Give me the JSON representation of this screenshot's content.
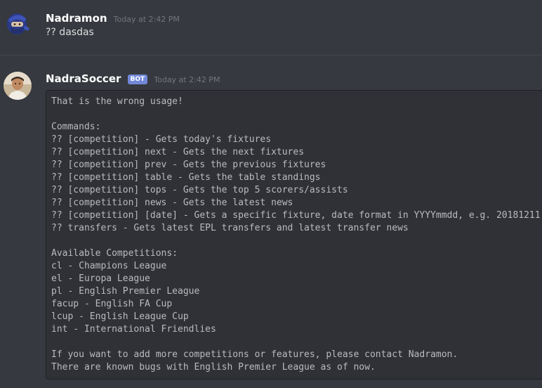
{
  "messages": [
    {
      "author": "Nadramon",
      "timestamp": "Today at 2:42 PM",
      "text": "?? dasdas"
    },
    {
      "author": "NadraSoccer",
      "bot_tag": "BOT",
      "timestamp": "Today at 2:42 PM",
      "code_lines": [
        "That is the wrong usage!",
        "",
        "Commands:",
        "?? [competition] - Gets today's fixtures",
        "?? [competition] next - Gets the next fixtures",
        "?? [competition] prev - Gets the previous fixtures",
        "?? [competition] table - Gets the table standings",
        "?? [competition] tops - Gets the top 5 scorers/assists",
        "?? [competition] news - Gets the latest news",
        "?? [competition] [date] - Gets a specific fixture, date format in YYYYmmdd, e.g. 20181211",
        "?? transfers - Gets latest EPL transfers and latest transfer news",
        "",
        "Available Competitions:",
        "cl - Champions League",
        "el - Europa League",
        "pl - English Premier League",
        "facup - English FA Cup",
        "lcup - English League Cup",
        "int - International Friendlies",
        "",
        "If you want to add more competitions or features, please contact Nadramon.",
        "There are known bugs with English Premier League as of now."
      ]
    }
  ],
  "colors": {
    "background": "#36393f",
    "codeblock_bg": "#2f3136",
    "bot_tag": "#7289da",
    "username": "#ffffff",
    "timestamp": "#72767d"
  },
  "icons": {
    "avatar1": "ninja-avatar",
    "avatar2": "person-avatar"
  }
}
